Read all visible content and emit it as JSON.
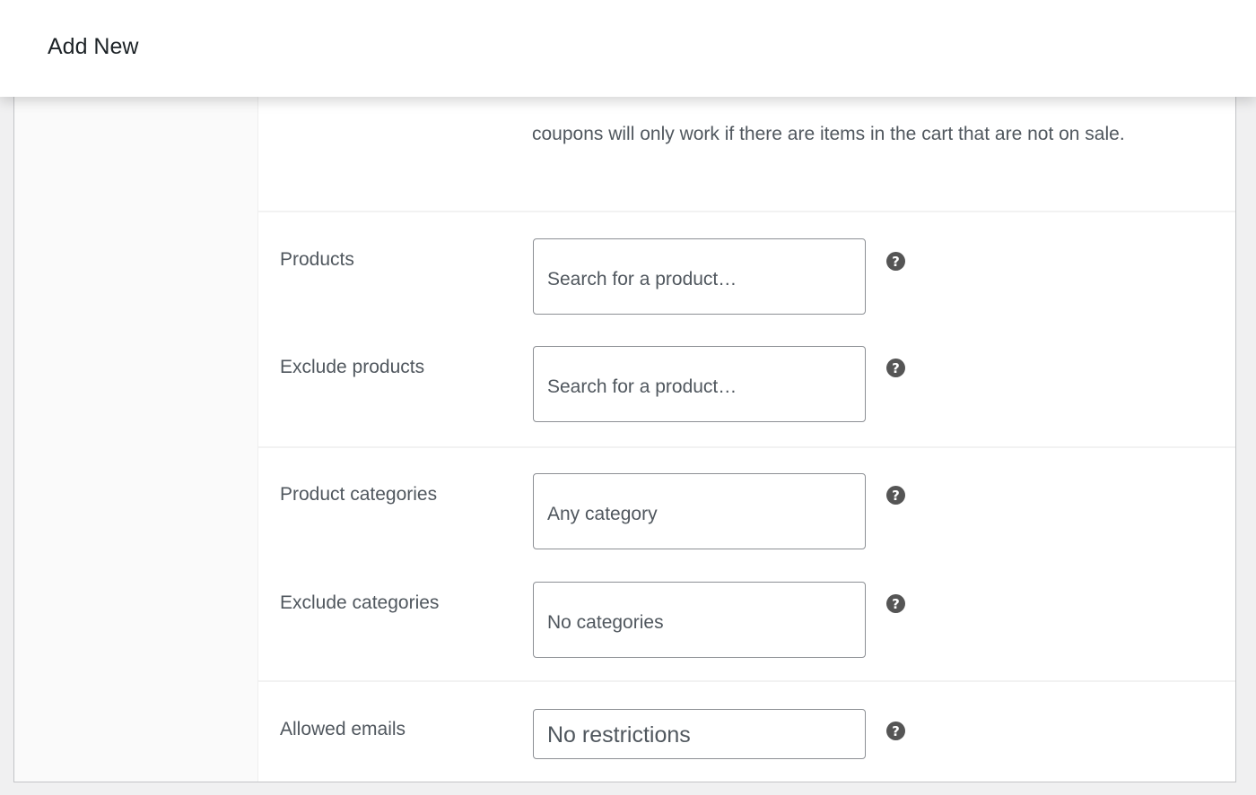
{
  "header": {
    "title": "Add New"
  },
  "description": {
    "text": "coupons will only work if there are items in the cart that are not on sale."
  },
  "fields": {
    "products": {
      "label": "Products",
      "placeholder": "Search for a product…"
    },
    "exclude_products": {
      "label": "Exclude products",
      "placeholder": "Search for a product…"
    },
    "product_categories": {
      "label": "Product categories",
      "placeholder": "Any category"
    },
    "exclude_categories": {
      "label": "Exclude categories",
      "placeholder": "No categories"
    },
    "allowed_emails": {
      "label": "Allowed emails",
      "placeholder": "No restrictions"
    }
  },
  "help_icon": {
    "glyph": "?"
  },
  "colors": {
    "help_icon": "#555555",
    "field_border": "#8c8f94",
    "text": "#50575e"
  }
}
